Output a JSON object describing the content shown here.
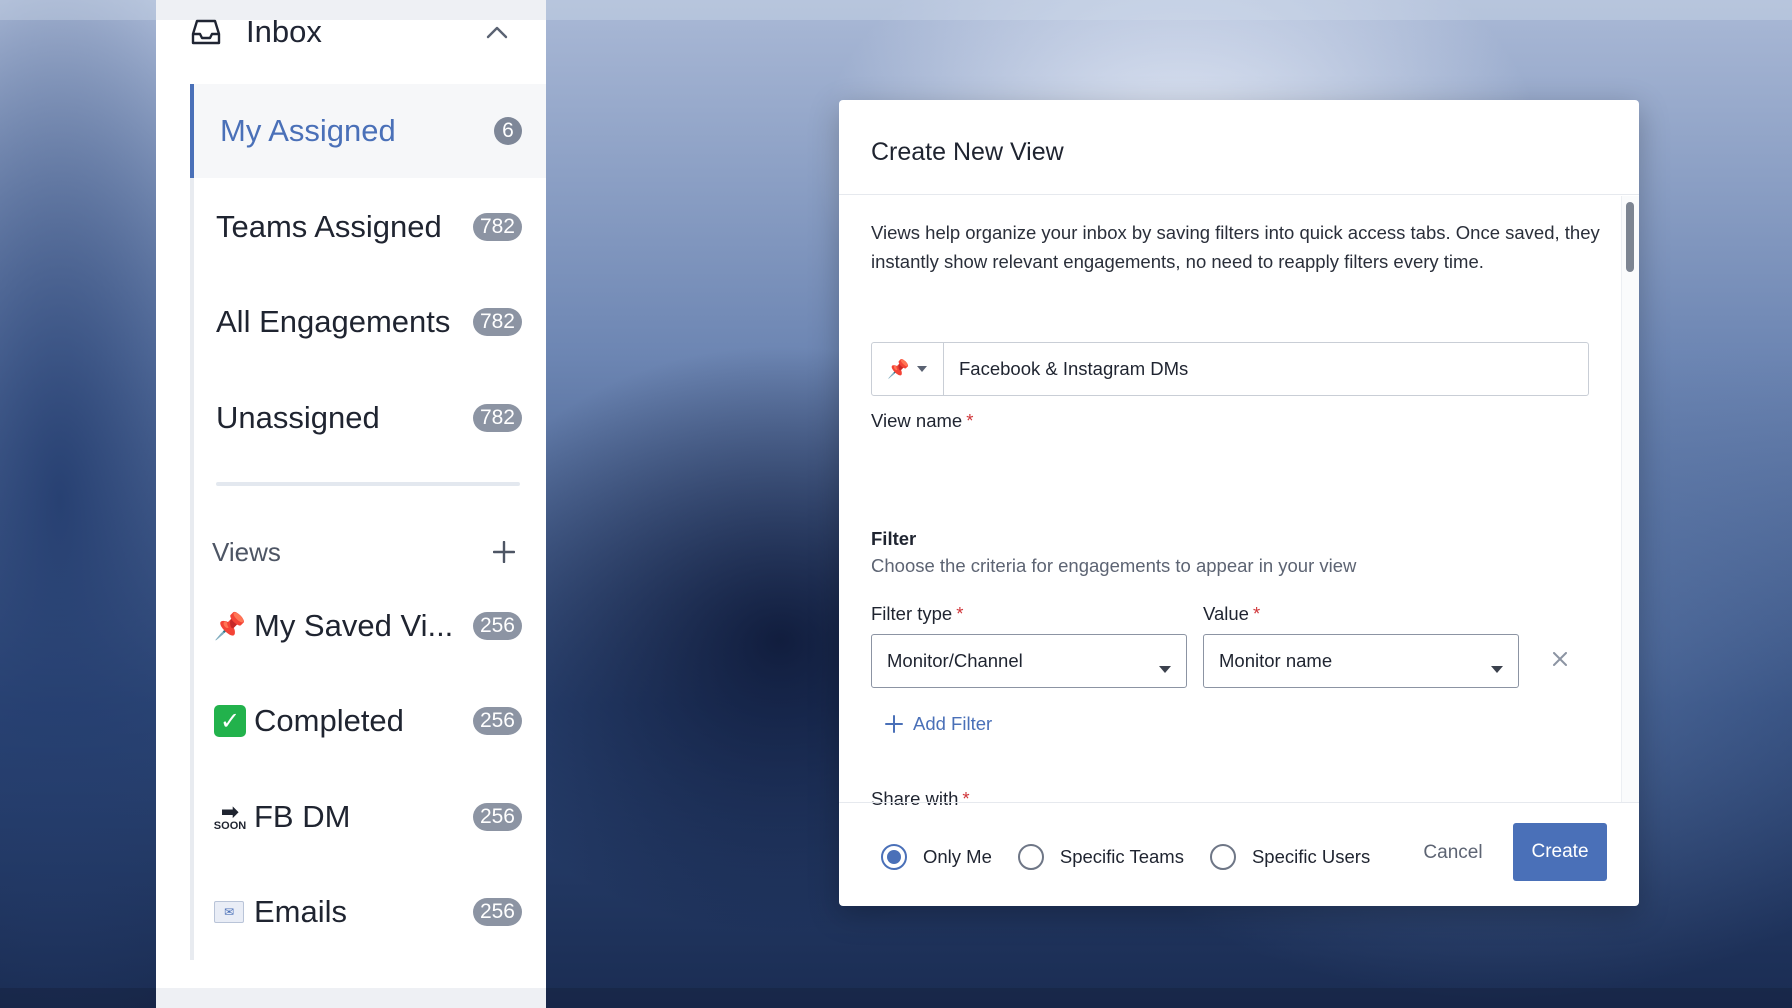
{
  "sidebar": {
    "inbox_label": "Inbox",
    "nav_items": [
      {
        "label": "My Assigned",
        "count": "6",
        "active": true
      },
      {
        "label": "Teams Assigned",
        "count": "782"
      },
      {
        "label": "All Engagements",
        "count": "782"
      },
      {
        "label": "Unassigned",
        "count": "782"
      }
    ],
    "views_label": "Views",
    "views": [
      {
        "emoji": "📌",
        "icon": "pushpin-icon",
        "label": "My Saved Vi...",
        "count": "256"
      },
      {
        "emoji": "✓",
        "icon": "check-mark-button-icon",
        "label": "Completed",
        "count": "256"
      },
      {
        "emoji": "➡",
        "emoji_text": "SOON",
        "icon": "soon-arrow-icon",
        "label": "FB DM",
        "count": "256"
      },
      {
        "emoji": "✉",
        "icon": "newspaper-icon",
        "label": "Emails",
        "count": "256"
      }
    ]
  },
  "modal": {
    "title": "Create New View",
    "description": "Views help organize your inbox by saving filters into quick access tabs. Once saved, they instantly show relevant engagements, no need to reapply filters every time.",
    "view_name_label": "View name",
    "required_mark": "*",
    "view_name_emoji": "📌",
    "view_name_value": "Facebook & Instagram DMs",
    "filter_title": "Filter",
    "filter_subtitle": "Choose the criteria for engagements to appear in your view",
    "filter_type_label": "Filter type",
    "filter_type_value": "Monitor/Channel",
    "value_label": "Value",
    "value_value": "Monitor name",
    "add_filter_label": "Add Filter",
    "share_with_label": "Share with",
    "share_options": [
      "Only Me",
      "Specific Teams",
      "Specific Users"
    ],
    "share_selected": "Only Me",
    "cancel_label": "Cancel",
    "create_label": "Create"
  },
  "colors": {
    "accent": "#4a70b8",
    "badge": "#8c94a3",
    "required": "#d0363a"
  }
}
